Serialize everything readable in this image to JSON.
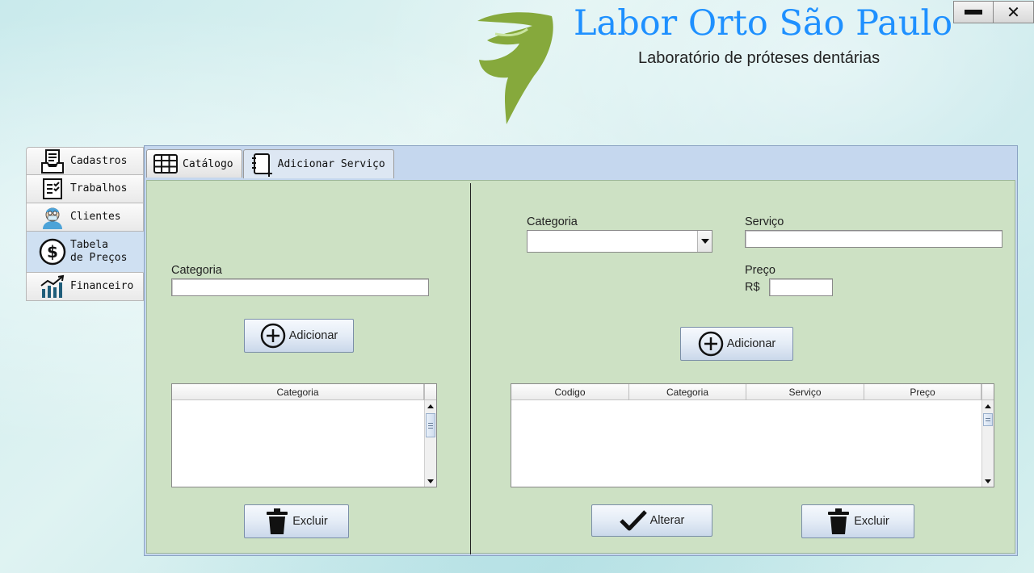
{
  "window": {
    "minimize_icon": "minimize-icon",
    "close_icon": "close-icon",
    "close_glyph": "✕"
  },
  "header": {
    "title": "Labor Orto São Paulo",
    "subtitle": "Laboratório de próteses dentárias",
    "title_color": "#1e90ff",
    "logo_icon": "tooth-logo-icon",
    "logo_color": "#86a93c"
  },
  "sidebar": {
    "items": [
      {
        "label": "Cadastros",
        "icon": "register-icon"
      },
      {
        "label": "Trabalhos",
        "icon": "checklist-icon"
      },
      {
        "label": "Clientes",
        "icon": "dentist-icon"
      },
      {
        "label_line1": "Tabela",
        "label_line2": "de Preços",
        "icon": "dollar-icon",
        "active": true
      },
      {
        "label": "Financeiro",
        "icon": "chart-icon"
      }
    ]
  },
  "tabs": [
    {
      "label": "Catálogo",
      "icon": "table-icon"
    },
    {
      "label": "Adicionar Serviço",
      "icon": "add-document-icon",
      "active": true
    }
  ],
  "left_panel": {
    "category_label": "Categoria",
    "category_value": "",
    "add_button": "Adicionar",
    "table_headers": [
      "Categoria"
    ],
    "delete_button": "Excluir"
  },
  "right_panel": {
    "category_label": "Categoria",
    "category_selected": "",
    "service_label": "Serviço",
    "service_value": "",
    "price_label": "Preço",
    "currency": "R$",
    "price_value": "",
    "add_button": "Adicionar",
    "table_headers": [
      "Codigo",
      "Categoria",
      "Serviço",
      "Preço"
    ],
    "edit_button": "Alterar",
    "delete_button": "Excluir"
  },
  "colors": {
    "content_bg": "#cde1c4",
    "panel_bg": "#c5d7ee",
    "active_nav": "#cfe0f2"
  }
}
